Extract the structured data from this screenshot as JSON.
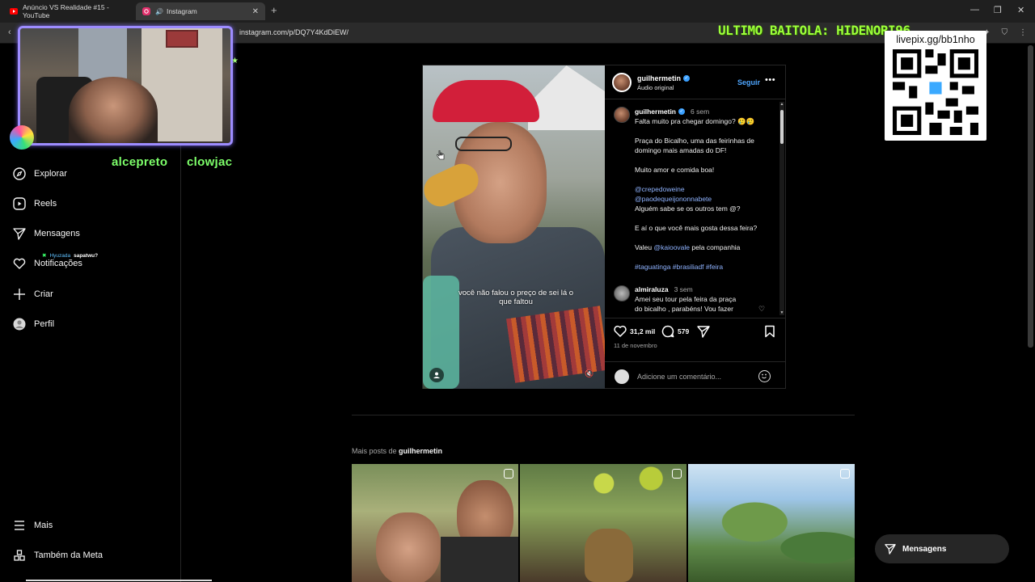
{
  "browser": {
    "tabs": [
      {
        "label": "Anúncio VS Realidade #15 - YouTube",
        "active": false
      },
      {
        "label": "Instagram",
        "active": true
      }
    ],
    "url": "instagram.com/p/DQ7Y4KdDiEW/",
    "window_controls": [
      "—",
      "❐",
      "✕"
    ]
  },
  "overlay": {
    "names": [
      "alcepreto",
      "clowjac"
    ],
    "banner": "ULTIMO BAITOLA: HIDENORI96",
    "qr_title": "livepix.gg/bb1nho",
    "accent_color": "#9d8cff"
  },
  "sidebar": {
    "items": [
      {
        "label": "Explorar",
        "icon": "compass-icon"
      },
      {
        "label": "Reels",
        "icon": "reels-icon"
      },
      {
        "label": "Mensagens",
        "icon": "send-icon"
      },
      {
        "label": "Notificações",
        "icon": "heart-icon"
      },
      {
        "label": "Criar",
        "icon": "plus-icon"
      },
      {
        "label": "Perfil",
        "icon": "profile-icon"
      }
    ],
    "bottom_items": [
      {
        "label": "Mais",
        "icon": "menu-icon"
      },
      {
        "label": "Também da Meta",
        "icon": "meta-icon"
      }
    ],
    "chat_user": "Hyuzada",
    "chat_message": "sapatwu?"
  },
  "post": {
    "username": "guilhermetin",
    "audio": "Áudio original",
    "follow_label": "Seguir",
    "video_subtitle": "você não falou o preço de sei lá o que faltou",
    "caption": {
      "username": "guilhermetin",
      "time": "6 sem",
      "lines": [
        {
          "text": "Falta muito pra chegar domingo? 🥲🥲",
          "link": false
        },
        {
          "text": "Praça do Bicalho, uma das feirinhas de",
          "link": false
        },
        {
          "text": "domingo mais amadas do DF!",
          "link": false
        },
        {
          "text": "Muito amor e comida boa!",
          "link": false
        },
        {
          "text": "@crepedoweine",
          "link": true
        },
        {
          "text": "@paodequeijononnabete",
          "link": true
        },
        {
          "text": "Alguém sabe se os outros tem @?",
          "link": false
        },
        {
          "text": "E aí o que você mais gosta dessa feira?",
          "link": false
        },
        {
          "text": "Valeu @kaioovale pela companhia",
          "link": false
        },
        {
          "text": "#taguatinga #brasiliadf #feira",
          "link": true
        }
      ]
    },
    "comment": {
      "username": "almiraluza",
      "time": "3 sem",
      "lines": [
        "Amei seu tour pela feira da praça",
        "do bicalho , parabéns! Vou fazer"
      ]
    },
    "likes": "31,2 mil",
    "comments_count": "579",
    "date": "11 de novembro",
    "add_comment_placeholder": "Adicione um comentário..."
  },
  "more_posts": {
    "prefix": "Mais posts de",
    "username": "guilhermetin"
  },
  "messages_pill": "Mensagens",
  "colors": {
    "link": "#8fb3ff",
    "follow": "#4ea6ff",
    "overlay_green": "#7dff6a"
  }
}
